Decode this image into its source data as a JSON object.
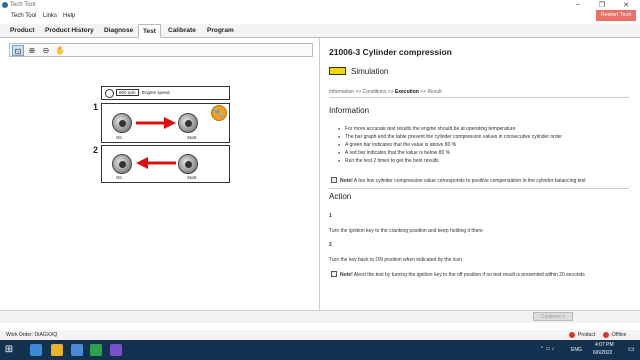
{
  "window": {
    "title": "Tech Tool",
    "restart_label": "Restart Tech Tool"
  },
  "menu": {
    "items": [
      "Tech Tool",
      "Links",
      "Help"
    ]
  },
  "tabs": [
    "Product",
    "Product History",
    "Diagnose",
    "Test",
    "Calibrate",
    "Program"
  ],
  "active_tab": "Test",
  "toolbar": {
    "icons": [
      "zoom-fit-icon",
      "zoom-in-icon",
      "zoom-out-icon",
      "pan-hand-icon"
    ]
  },
  "diagram": {
    "speed_label": "600 rpm",
    "speed_caption": "Engine speed",
    "step1_number": "1",
    "step2_number": "2",
    "on_label": "On",
    "start_label": "Start"
  },
  "test": {
    "title": "21006-3 Cylinder compression",
    "mode": "Simulation",
    "mode_color": "#f2d600",
    "breadcrumb_info": "Information",
    "breadcrumb_sep": ">>",
    "breadcrumb_conditions": "Conditions",
    "breadcrumb_execution": "Execution",
    "breadcrumb_result": "Result"
  },
  "information": {
    "heading": "Information",
    "bullets": [
      "For more accurate test results the engine should be at operating temperature",
      "The bar graph and the table present the cylinder compression values in consecutive cylinder order",
      "A green bar indicates that the value is above 80 %",
      "A red bar indicates that the value is below 80 %",
      "Run the test 2 times to get the best results"
    ],
    "note_label": "Note!",
    "note_text": "A too low cylinder compression value corresponds to positive compensation in the cylinder balancing test"
  },
  "action": {
    "heading": "Action",
    "step1_num": "1",
    "step1_text": "Turn the ignition key to the cranking position and keep holding it there",
    "step2_num": "2",
    "step2_text": "Turn the key back to ON position when indicated by the icon",
    "note_label": "Note!",
    "note_text": "Abort the test by turning the ignition key to the off position if no test result is presented within 20 seconds"
  },
  "footer": {
    "continue_label": "Continue >",
    "work_order": "Work Order: DIAGXXQ",
    "product_label": "Product",
    "offline_label": "Offline"
  },
  "taskbar": {
    "lang": "ENG",
    "time": "4:07 PM",
    "date": "6/6/2022"
  }
}
